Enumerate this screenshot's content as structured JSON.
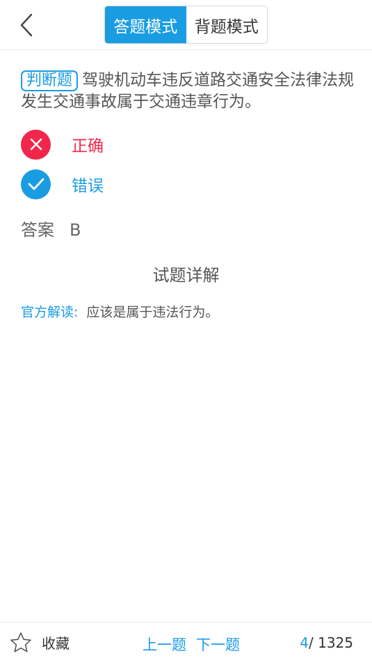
{
  "header": {
    "modes": [
      "答题模式",
      "背题模式"
    ],
    "active_mode": 0
  },
  "question": {
    "type": "判断题",
    "text": "驾驶机动车违反道路交通安全法律法规发生交通事故属于交通违章行为。"
  },
  "options": [
    {
      "label": "正确",
      "state": "wrong",
      "icon": "close-icon"
    },
    {
      "label": "错误",
      "state": "correct",
      "icon": "check-icon"
    }
  ],
  "answer": {
    "label": "答案",
    "value": "B"
  },
  "explanation": {
    "title": "试题详解",
    "source_label": "官方解读:",
    "text": "应该是属于违法行为。"
  },
  "bottom": {
    "favorite_label": "收藏",
    "prev_label": "上一题",
    "next_label": "下一题",
    "current": "4",
    "separator": "/",
    "total": "1325"
  },
  "colors": {
    "accent": "#1a9ce3",
    "wrong": "#f2264b"
  }
}
